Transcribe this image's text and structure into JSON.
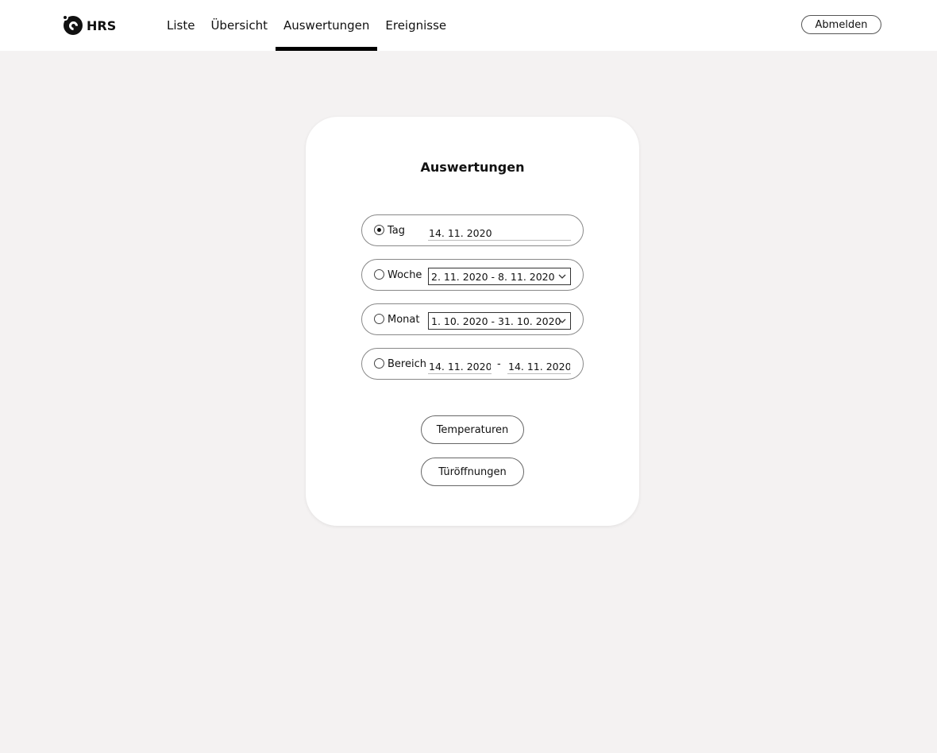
{
  "brand": {
    "name": "HRS"
  },
  "nav": {
    "items": [
      {
        "label": "Liste"
      },
      {
        "label": "Übersicht"
      },
      {
        "label": "Auswertungen"
      },
      {
        "label": "Ereignisse"
      }
    ],
    "active": "Auswertungen"
  },
  "header": {
    "logout_label": "Abmelden"
  },
  "card": {
    "title": "Auswertungen",
    "options": {
      "day": {
        "label": "Tag",
        "value": "14. 11. 2020",
        "checked": true
      },
      "week": {
        "label": "Woche",
        "selected": "2. 11. 2020 - 8. 11. 2020",
        "checked": false
      },
      "month": {
        "label": "Monat",
        "selected": "1. 10. 2020 - 31. 10. 2020",
        "checked": false
      },
      "range": {
        "label": "Bereich",
        "from": "14. 11. 2020",
        "separator": "-",
        "to": "14. 11. 2020",
        "checked": false
      }
    },
    "buttons": {
      "temperatures": "Temperaturen",
      "door_openings": "Türöffnungen"
    }
  },
  "icons": [
    "hrs-logo-icon",
    "chevron-down-icon"
  ]
}
